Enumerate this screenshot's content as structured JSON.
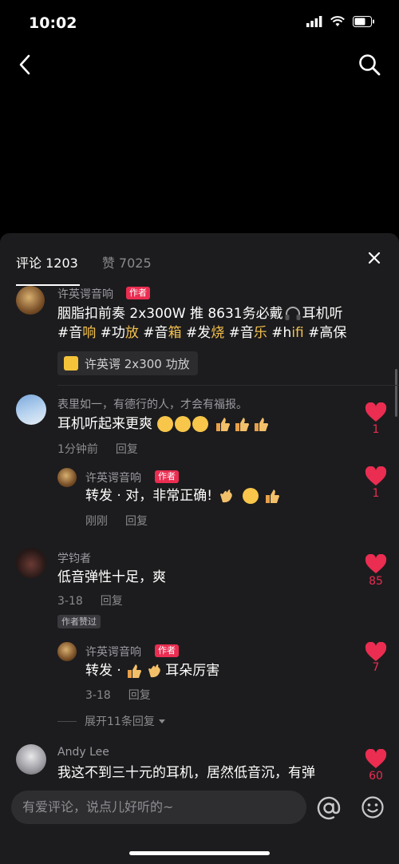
{
  "status": {
    "time": "10:02"
  },
  "tabs": [
    {
      "label": "评论 1203"
    },
    {
      "label": "赞 7025"
    }
  ],
  "comments": {
    "c1": {
      "user": "许英谔音响",
      "badge": "作者",
      "line1_a": "胭脂扣前奏 2x300W 推 8631务必戴",
      "line1_b": "耳机听",
      "line2": [
        "#音",
        "响",
        " #功",
        "放",
        " #音",
        "箱",
        " #发",
        "烧",
        " #音",
        "乐",
        " #h",
        "ifi",
        " #高保"
      ],
      "product": "许英谔 2x300 功放"
    },
    "c2": {
      "user": "表里如一，有德行的人，才会有福报。",
      "text": "耳机听起来更爽",
      "time": "1分钟前",
      "reply": "回复",
      "likes": "1",
      "sub": {
        "user": "许英谔音响",
        "badge": "作者",
        "text_a": "转发 · 对，非常正确!",
        "time": "刚刚",
        "reply": "回复",
        "likes": "1"
      }
    },
    "c3": {
      "user": "学钧者",
      "text": "低音弹性十足，爽",
      "time": "3-18",
      "reply": "回复",
      "liked_tag": "作者赞过",
      "likes": "85",
      "sub": {
        "user": "许英谔音响",
        "badge": "作者",
        "text_a": "转发 · ",
        "text_b": "耳朵厉害",
        "time": "3-18",
        "reply": "回复",
        "likes": "7"
      },
      "expand": "展开11条回复"
    },
    "c4": {
      "user": "Andy Lee",
      "text": "我这不到三十元的耳机，居然低音沉，有弹",
      "likes": "60"
    }
  },
  "input": {
    "placeholder": "有爱评论，说点儿好听的~"
  },
  "colors": {
    "accent": "#ea2d51",
    "tag": "#f5c14e",
    "sheet": "#1c1c1e"
  }
}
